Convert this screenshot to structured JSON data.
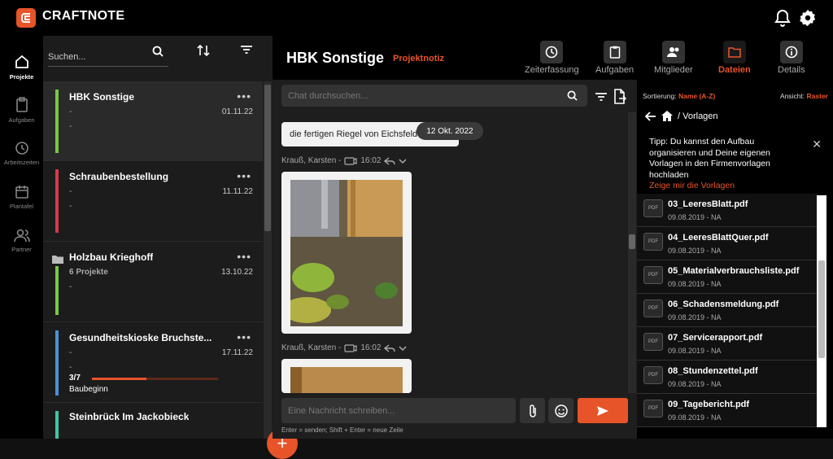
{
  "app": {
    "name": "CRAFTNOTE",
    "accent": "#e8542a"
  },
  "leftnav": [
    {
      "label": "Projekte",
      "icon": "home-icon",
      "active": true
    },
    {
      "label": "Aufgaben",
      "icon": "clipboard-icon"
    },
    {
      "label": "Arbeitszeiten",
      "icon": "clock-icon"
    },
    {
      "label": "Plantafel",
      "icon": "calendar-icon"
    },
    {
      "label": "Partner",
      "icon": "users-icon"
    }
  ],
  "projects_panel": {
    "search_placeholder": "Suchen...",
    "items": [
      {
        "name": "HBK Sonstige",
        "line1": "-",
        "line2": "-",
        "date": "01.11.22",
        "color": "#7ac943",
        "selected": true
      },
      {
        "name": "Schraubenbestellung",
        "line1": "-",
        "line2": "-",
        "date": "11.11.22",
        "color": "#d63a4a"
      },
      {
        "name": "Holzbau Krieghoff",
        "line1": "6 Projekte",
        "line2": "-",
        "date": "13.10.22",
        "color": "#7ac943",
        "folder": true
      },
      {
        "name": "Gesundheitskioske Bruchste...",
        "line1": "-",
        "line2": "-",
        "date": "17.11.22",
        "color": "#4a90d9",
        "progress_label": "3/7",
        "progress": 0.43,
        "status": "Baubeginn"
      },
      {
        "name": "Steinbrück Im Jackobieck",
        "color": "#3fc7a7"
      }
    ],
    "fab_label": "+"
  },
  "chat": {
    "title": "HBK Sonstige",
    "tag": "Projektnotiz",
    "tabs": [
      {
        "label": "Zeiterfassung",
        "icon": "clock-icon"
      },
      {
        "label": "Aufgaben",
        "icon": "clipboard-icon"
      },
      {
        "label": "Mitglieder",
        "icon": "users-icon"
      },
      {
        "label": "Dateien",
        "icon": "folder-icon",
        "active": true
      },
      {
        "label": "Details",
        "icon": "info-icon"
      }
    ],
    "search_placeholder": "Chat durchsuchen...",
    "message_text": "die fertigen Riegel von Eichsfeld",
    "date_pill": "12 Okt. 2022",
    "messages": [
      {
        "author": "Krauß, Karsten -",
        "time": "16:02"
      },
      {
        "author": "Krauß, Karsten -",
        "time": "16:02"
      }
    ],
    "compose_placeholder": "Eine Nachricht schreiben...",
    "hint": "Enter = senden; Shift + Enter = neue Zeile"
  },
  "files": {
    "sort_label": "Sortierung:",
    "sort_value": "Name (A-Z)",
    "view_label": "Ansicht:",
    "view_value": "Raster",
    "breadcrumb": "/ Vorlagen",
    "tip_text": "Tipp: Du kannst den Aufbau organisieren und Deine eigenen Vorlagen in den Firmenvorlagen hochladen",
    "tip_link": "Zeige mir die Vorlagen",
    "icon_label": "PDF",
    "items": [
      {
        "name": "03_LeeresBlatt.pdf",
        "meta": "09.08.2019 - NA"
      },
      {
        "name": "04_LeeresBlattQuer.pdf",
        "meta": "09.08.2019 - NA"
      },
      {
        "name": "05_Materialverbrauchsliste.pdf",
        "meta": "09.08.2019 - NA"
      },
      {
        "name": "06_Schadensmeldung.pdf",
        "meta": "09.08.2019 - NA"
      },
      {
        "name": "07_Servicerapport.pdf",
        "meta": "09.08.2019 - NA"
      },
      {
        "name": "08_Stundenzettel.pdf",
        "meta": "09.08.2019 - NA"
      },
      {
        "name": "09_Tagebericht.pdf",
        "meta": "09.08.2019 - NA"
      }
    ]
  }
}
